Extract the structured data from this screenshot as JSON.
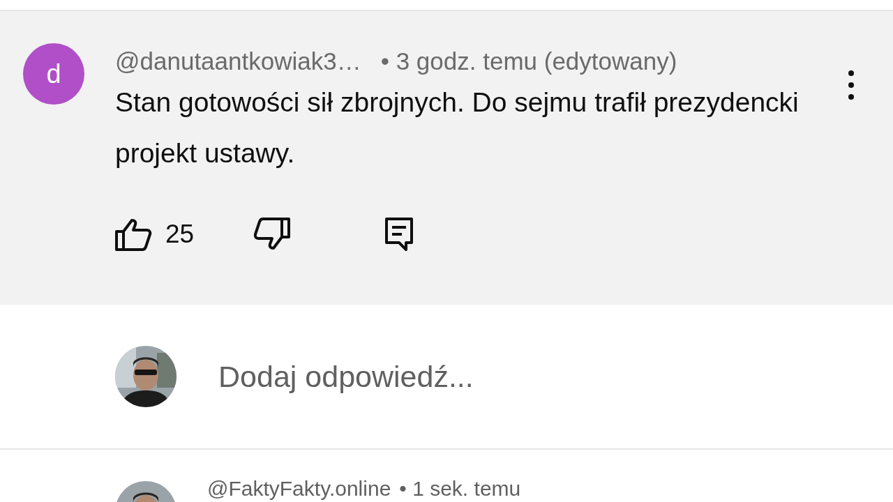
{
  "comment": {
    "avatar_letter": "d",
    "author": "@danutaantkowiak3…",
    "meta": "• 3 godz. temu (edytowany)",
    "text": "Stan gotowości sił zbrojnych. Do sejmu trafił prezydencki projekt ustawy.",
    "likes": "25"
  },
  "reply_field": {
    "placeholder": "Dodaj odpowiedź..."
  },
  "next_comment": {
    "author": "@FaktyFakty.online",
    "meta": "• 1 sek. temu"
  }
}
